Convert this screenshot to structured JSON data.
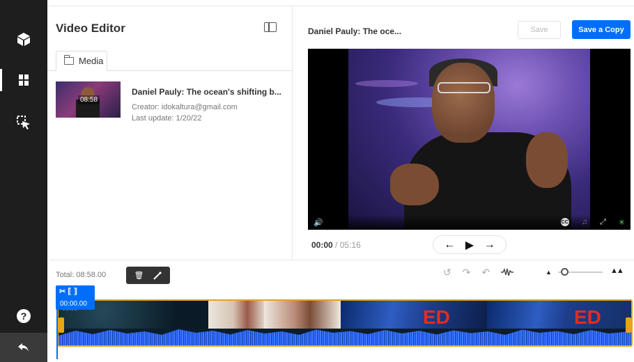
{
  "rail": {
    "items": [
      "box-icon",
      "split-icon",
      "select-cursor-icon"
    ],
    "help_label": "?",
    "undo_icon": "undo-arrow-icon"
  },
  "left_panel": {
    "title": "Video Editor",
    "tab_media": "Media",
    "media_item": {
      "thumb_duration": "08:58",
      "name": "Daniel Pauly: The ocean's shifting b...",
      "creator": "Creator: idokaltura@gmail.com",
      "last_update": "Last update: 1/20/22"
    }
  },
  "right_panel": {
    "video_title": "Daniel Pauly: The oce...",
    "save_label": "Save",
    "save_copy_label": "Save a Copy",
    "time_current": "00:00",
    "time_separator": "/",
    "time_total": "05:16"
  },
  "player_controls": {
    "volume_glyph": "🔊",
    "cc_label": "CC",
    "music_glyph": "♫",
    "fullscreen_glyph": "⤢",
    "colors_glyph": "✳"
  },
  "transport": {
    "back_glyph": "←",
    "play_glyph": "▶",
    "forward_glyph": "→"
  },
  "timeline": {
    "total_label": "Total: 08:58.00",
    "playhead_time": "00:00.00",
    "playhead_under_time": "00:00",
    "trim_delete_glyph": "🗑",
    "trim_wand_glyph": "⁄",
    "tools": {
      "reset_glyph": "↺",
      "redo_glyph": "↷",
      "undo_glyph": "↶",
      "audio_glyph": "⩘⩗⩘"
    },
    "zoom": {
      "level": 0.15
    },
    "ted_label": "ED"
  },
  "colors": {
    "accent": "#006efa",
    "clip_border": "#e8a317",
    "rail_bg": "#1e1e1e"
  }
}
